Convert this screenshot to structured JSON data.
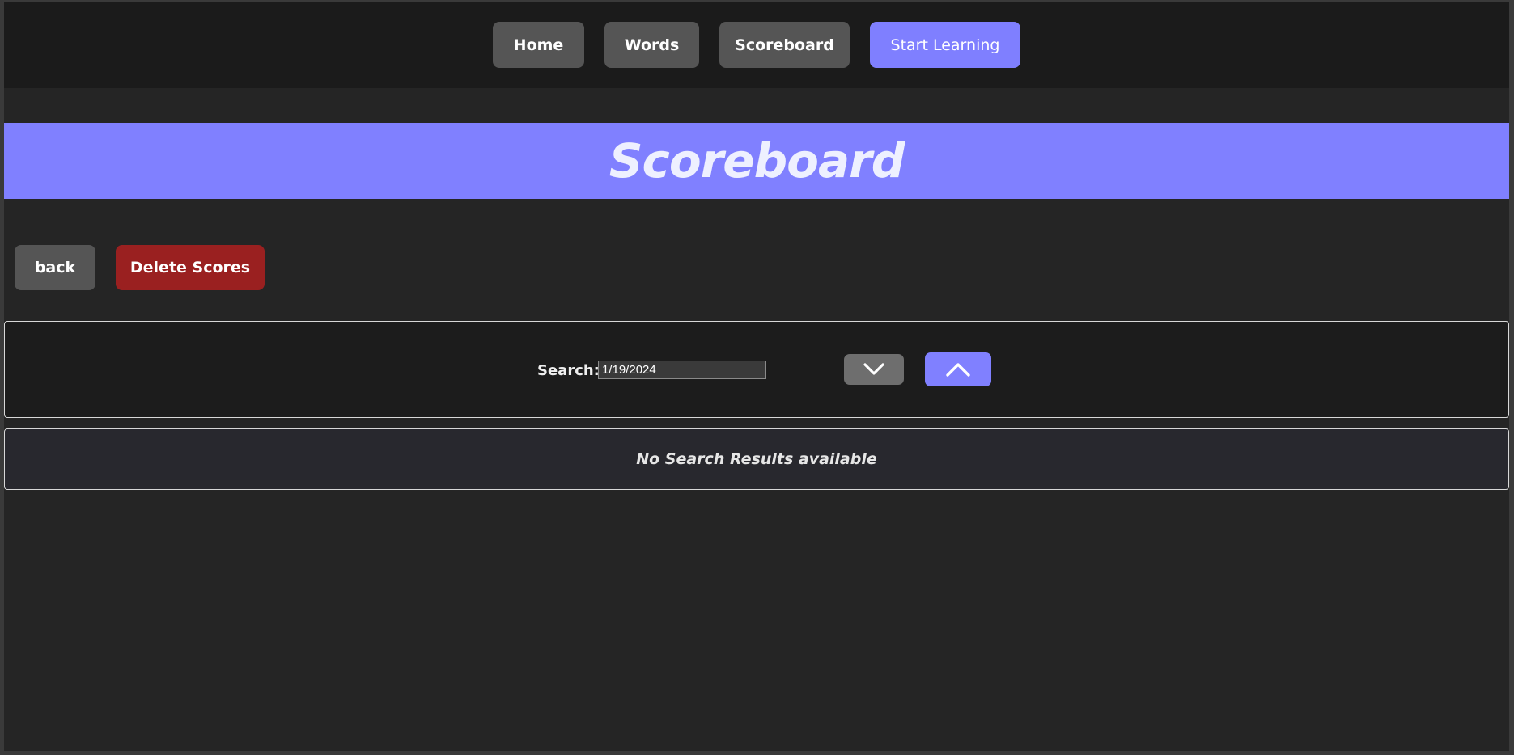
{
  "nav": {
    "home_label": "Home",
    "words_label": "Words",
    "scoreboard_label": "Scoreboard",
    "start_learning_label": "Start Learning"
  },
  "page": {
    "title": "Scoreboard"
  },
  "actions": {
    "back_label": "back",
    "delete_label": "Delete Scores"
  },
  "search": {
    "label": "Search:",
    "value": "1/19/2024",
    "sort_desc_icon": "chevron-down-icon",
    "sort_asc_icon": "chevron-up-icon"
  },
  "results": {
    "empty_message": "No Search Results available"
  },
  "colors": {
    "accent": "#8080ff",
    "danger": "#9a2020",
    "button_neutral": "#555555",
    "background": "#252525",
    "nav_background": "#1b1b1b"
  }
}
